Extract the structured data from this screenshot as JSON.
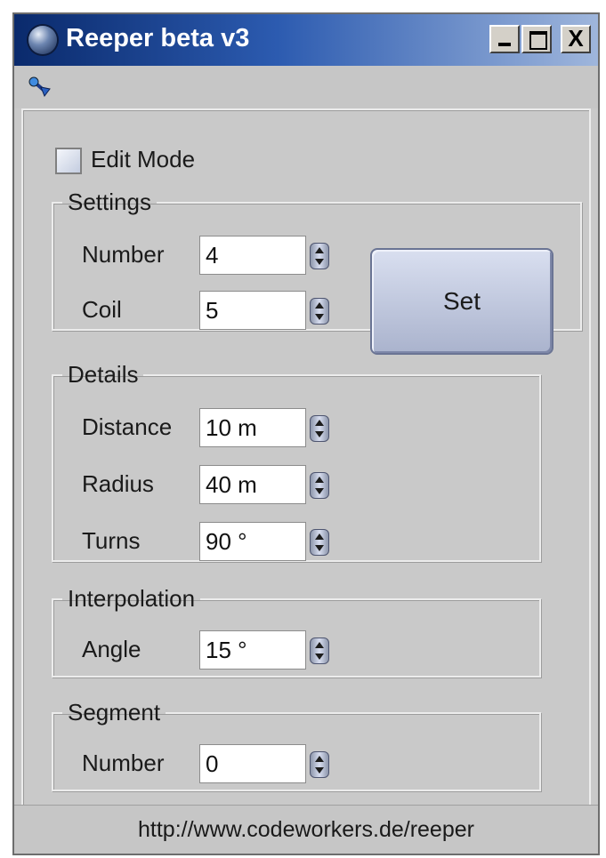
{
  "window": {
    "title": "Reeper beta v3"
  },
  "titlebar": {
    "minimize": "_",
    "maximize": "□",
    "close": "X"
  },
  "edit_mode": {
    "label": "Edit Mode",
    "checked": false
  },
  "settings": {
    "title": "Settings",
    "number": {
      "label": "Number",
      "value": "4"
    },
    "coil": {
      "label": "Coil",
      "value": "5"
    },
    "set_label": "Set"
  },
  "details": {
    "title": "Details",
    "distance": {
      "label": "Distance",
      "value": "10 m"
    },
    "radius": {
      "label": "Radius",
      "value": "40 m"
    },
    "turns": {
      "label": "Turns",
      "value": "90 °"
    }
  },
  "interpolation": {
    "title": "Interpolation",
    "angle": {
      "label": "Angle",
      "value": "15 °"
    }
  },
  "segment": {
    "title": "Segment",
    "number": {
      "label": "Number",
      "value": "0"
    }
  },
  "footer": {
    "url": "http://www.codeworkers.de/reeper"
  },
  "icons": {
    "app": "sphere-icon",
    "menu": "pin-icon"
  }
}
